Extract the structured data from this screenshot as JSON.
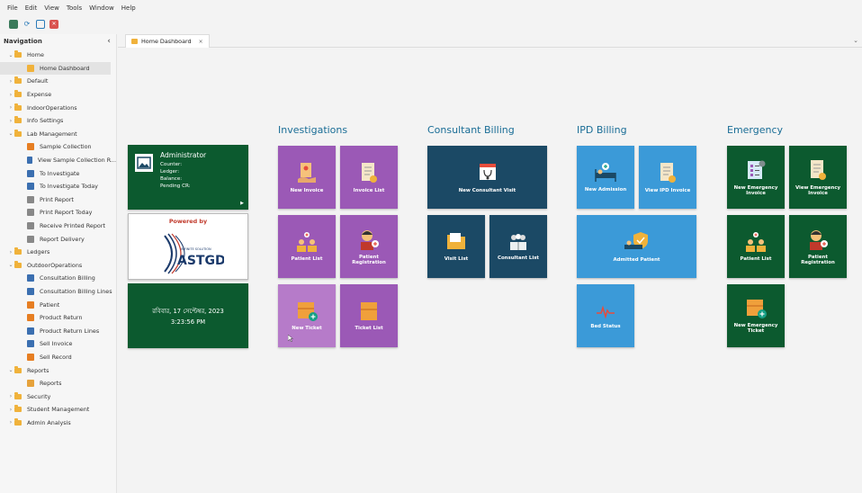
{
  "menu": [
    "File",
    "Edit",
    "View",
    "Tools",
    "Window",
    "Help"
  ],
  "navigation": {
    "title": "Navigation",
    "collapse_glyph": "‹",
    "items": [
      {
        "label": "Home",
        "level": 0,
        "expanded": true,
        "type": "folder"
      },
      {
        "label": "Home Dashboard",
        "level": 1,
        "type": "leaf",
        "icon": "dashboard-icon",
        "color": "#f0b23b",
        "selected": true
      },
      {
        "label": "Default",
        "level": 0,
        "expanded": false,
        "type": "folder"
      },
      {
        "label": "Expense",
        "level": 0,
        "expanded": false,
        "type": "folder"
      },
      {
        "label": "IndoorOperations",
        "level": 0,
        "expanded": false,
        "type": "folder"
      },
      {
        "label": "Info Settings",
        "level": 0,
        "expanded": false,
        "type": "folder"
      },
      {
        "label": "Lab Management",
        "level": 0,
        "expanded": true,
        "type": "folder"
      },
      {
        "label": "Sample Collection",
        "level": 1,
        "type": "leaf",
        "icon": "flask-icon",
        "color": "#e67e22"
      },
      {
        "label": "View Sample Collection R...",
        "level": 1,
        "type": "leaf",
        "icon": "person-icon",
        "color": "#3b6fb0"
      },
      {
        "label": "To Investigate",
        "level": 1,
        "type": "leaf",
        "icon": "document-icon",
        "color": "#3b6fb0"
      },
      {
        "label": "To Investigate Today",
        "level": 1,
        "type": "leaf",
        "icon": "document-icon",
        "color": "#3b6fb0"
      },
      {
        "label": "Print Report",
        "level": 1,
        "type": "leaf",
        "icon": "report-icon",
        "color": "#888888"
      },
      {
        "label": "Print Report Today",
        "level": 1,
        "type": "leaf",
        "icon": "report-icon",
        "color": "#888888"
      },
      {
        "label": "Receive Printed Report",
        "level": 1,
        "type": "leaf",
        "icon": "report-icon",
        "color": "#888888"
      },
      {
        "label": "Report Delivery",
        "level": 1,
        "type": "leaf",
        "icon": "report-icon",
        "color": "#888888"
      },
      {
        "label": "Ledgers",
        "level": 0,
        "expanded": false,
        "type": "folder"
      },
      {
        "label": "OutdoorOperations",
        "level": 0,
        "expanded": true,
        "type": "folder"
      },
      {
        "label": "Consultation Billing",
        "level": 1,
        "type": "leaf",
        "icon": "person-icon",
        "color": "#3b6fb0"
      },
      {
        "label": "Consultation Billing Lines",
        "level": 1,
        "type": "leaf",
        "icon": "person-icon",
        "color": "#3b6fb0"
      },
      {
        "label": "Patient",
        "level": 1,
        "type": "leaf",
        "icon": "patient-icon",
        "color": "#e67e22"
      },
      {
        "label": "Product Return",
        "level": 1,
        "type": "leaf",
        "icon": "return-icon",
        "color": "#e67e22"
      },
      {
        "label": "Product Return Lines",
        "level": 1,
        "type": "leaf",
        "icon": "person-icon",
        "color": "#3b6fb0"
      },
      {
        "label": "Sell Invoice",
        "level": 1,
        "type": "leaf",
        "icon": "person-icon",
        "color": "#3b6fb0"
      },
      {
        "label": "Sell Record",
        "level": 1,
        "type": "leaf",
        "icon": "sell-icon",
        "color": "#e67e22"
      },
      {
        "label": "Reports",
        "level": 0,
        "expanded": true,
        "type": "folder"
      },
      {
        "label": "Reports",
        "level": 1,
        "type": "leaf",
        "icon": "clipboard-icon",
        "color": "#e6a23b"
      },
      {
        "label": "Security",
        "level": 0,
        "expanded": false,
        "type": "folder"
      },
      {
        "label": "Student Management",
        "level": 0,
        "expanded": false,
        "type": "folder"
      },
      {
        "label": "Admin Analysis",
        "level": 0,
        "expanded": false,
        "type": "folder"
      }
    ]
  },
  "tab": {
    "label": "Home Dashboard",
    "close": "×",
    "dropdown": "⌄"
  },
  "admin_card": {
    "name": "Administrator",
    "counter": "Counter:",
    "ledger": "Ledger:",
    "balance": "Balance:",
    "pending": "Pending CR:",
    "arrow": "▶"
  },
  "powered_card": {
    "powered_by": "Powered by",
    "logo_small": "INFINITE SOLUTION",
    "logo_text": "ASTGD"
  },
  "date_card": {
    "date": "রবিবার, 17 সেপ্টেম্বর, 2023",
    "time": "3:23:56 PM"
  },
  "groups": {
    "investigations": {
      "title": "Investigations"
    },
    "consultant_billing": {
      "title": "Consultant Billing"
    },
    "ipd_billing": {
      "title": "IPD Billing"
    },
    "emergency": {
      "title": "Emergency"
    }
  },
  "tiles": {
    "new_invoice": "New Invoice",
    "invoice_list": "Invoice List",
    "patient_list_inv": "Patient List",
    "patient_registration_inv": "Patient\nRegistration",
    "new_ticket": "New Ticket",
    "ticket_list": "Ticket List",
    "new_consultant_visit": "New Consultant Visit",
    "visit_list": "Visit List",
    "consultant_list": "Consultant List",
    "new_admission": "New Admission",
    "view_ipd_invoice": "View IPD Invoice",
    "admitted_patient": "Admitted Patient",
    "bed_status": "Bed Status",
    "new_emergency_invoice": "New Emergency\nInvoice",
    "view_emergency_invoice": "View Emergency\nInvoice",
    "patient_list_em": "Patient List",
    "patient_registration_em": "Patient\nRegistration",
    "new_emergency_ticket": "New Emergency\nTicket"
  }
}
